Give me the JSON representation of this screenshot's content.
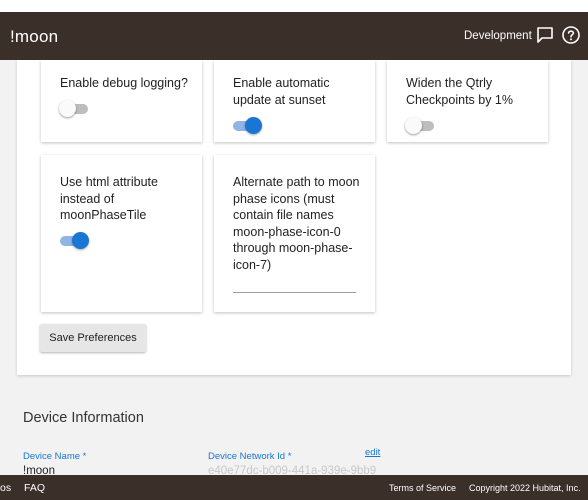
{
  "appbar": {
    "title": "!moon",
    "environment": "Development",
    "chat_icon": "chat-bubble-icon",
    "help_icon": "help-circle-icon"
  },
  "preferences": {
    "debug_logging": {
      "label": "Enable debug logging?",
      "enabled": false
    },
    "auto_update": {
      "label": "Enable automatic update at sunset",
      "enabled": true
    },
    "widen_checkpoints": {
      "label": "Widen the Qtrly Checkpoints by 1%",
      "enabled": false
    },
    "html_attribute": {
      "label": "Use html attribute instead of moonPhaseTile",
      "enabled": true
    },
    "icon_path": {
      "label": "Alternate path to moon phase icons (must contain file names moon-phase-icon-0 through moon-phase-icon-7)",
      "value": ""
    },
    "save_label": "Save Preferences"
  },
  "device_info": {
    "heading": "Device Information",
    "device_name_label": "Device Name *",
    "device_name_value": "!moon",
    "network_id_label": "Device Network Id *",
    "network_id_value": "e40e77dc-b009-441a-939e-9bb9",
    "edit_label": "edit"
  },
  "footer": {
    "left_fragment": "os",
    "faq": "FAQ",
    "terms": "Terms of Service",
    "copyright": "Copyright 2022 Hubitat, Inc."
  },
  "colors": {
    "appbar_bg": "#3b2f2a",
    "accent": "#1976d2",
    "page_bg": "#f2f2f2"
  }
}
